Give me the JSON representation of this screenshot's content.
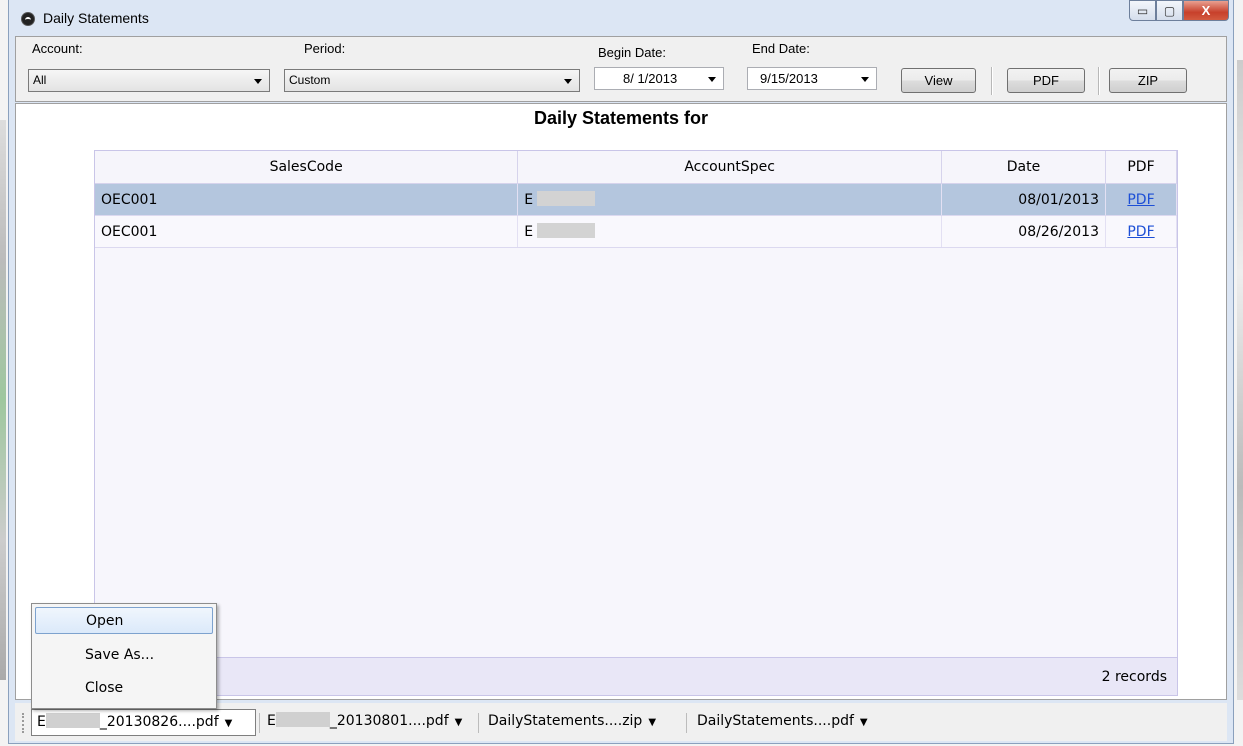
{
  "window": {
    "title": "Daily Statements",
    "controls": {
      "minimize": "▭",
      "maximize": "▢",
      "close": "X"
    }
  },
  "toolbar": {
    "account_label": "Account:",
    "account_value": "All",
    "period_label": "Period:",
    "period_value": "Custom",
    "begin_label": "Begin Date:",
    "begin_value": "8/ 1/2013",
    "end_label": "End Date:",
    "end_value": "9/15/2013",
    "view_label": "View",
    "pdf_label": "PDF",
    "zip_label": "ZIP"
  },
  "report": {
    "title": "Daily Statements for",
    "columns": [
      "SalesCode",
      "AccountSpec",
      "Date",
      "PDF"
    ],
    "rows": [
      {
        "salescode": "OEC001",
        "accountspec": "E",
        "date": "08/01/2013",
        "pdf": "PDF",
        "selected": true
      },
      {
        "salescode": "OEC001",
        "accountspec": "E",
        "date": "08/26/2013",
        "pdf": "PDF",
        "selected": false
      }
    ],
    "footer": "2 records"
  },
  "context_menu": {
    "items": [
      "Open",
      "Save As...",
      "Close"
    ]
  },
  "downloads": {
    "items": [
      {
        "prefix": "E",
        "name": "_20130826....pdf"
      },
      {
        "prefix": "E",
        "name": "_20130801....pdf"
      },
      {
        "prefix": "",
        "name": "DailyStatements....zip"
      },
      {
        "prefix": "",
        "name": "DailyStatements....pdf"
      }
    ]
  },
  "colors": {
    "selected_row": "#b4c6de",
    "link": "#1d4fd6",
    "menu_highlight": "#dbe9fa"
  }
}
